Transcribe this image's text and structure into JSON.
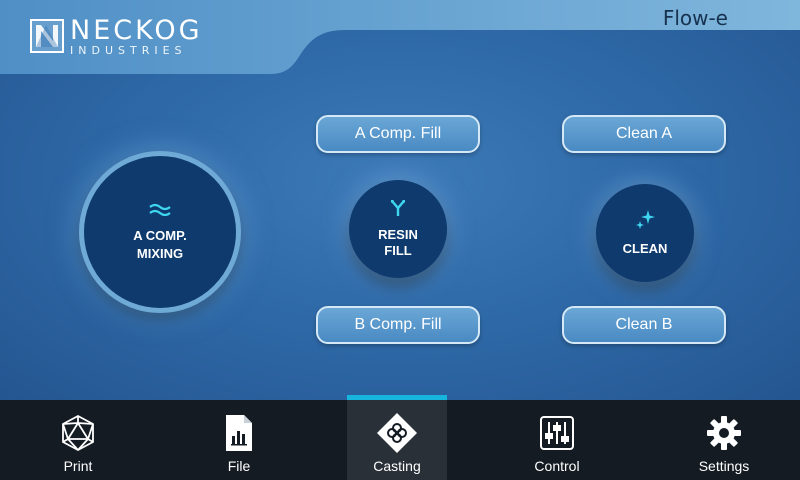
{
  "header": {
    "brand_name": "NECKOG",
    "brand_sub": "INDUSTRIES",
    "model": "Flow-e"
  },
  "main": {
    "mixing": {
      "label_line1": "A COMP.",
      "label_line2": "MIXING",
      "icon": "wave-icon"
    },
    "resin_fill": {
      "label_line1": "RESIN",
      "label_line2": "FILL",
      "icon": "merge-arrows-icon"
    },
    "clean": {
      "label": "CLEAN",
      "icon": "sparkle-icon"
    },
    "buttons": {
      "a_comp_fill": "A Comp. Fill",
      "b_comp_fill": "B Comp. Fill",
      "clean_a": "Clean A",
      "clean_b": "Clean B"
    }
  },
  "nav": {
    "items": [
      {
        "label": "Print",
        "icon": "d20-polyhedron-icon"
      },
      {
        "label": "File",
        "icon": "file-chart-icon"
      },
      {
        "label": "Casting",
        "icon": "casting-diamond-icon",
        "active": true
      },
      {
        "label": "Control",
        "icon": "sliders-icon"
      },
      {
        "label": "Settings",
        "icon": "gear-icon"
      }
    ]
  },
  "colors": {
    "accent": "#16b5de",
    "circle_fill": "#0e3a6e",
    "nav_bg": "#141b22",
    "icon_cyan": "#3fd7f0"
  }
}
